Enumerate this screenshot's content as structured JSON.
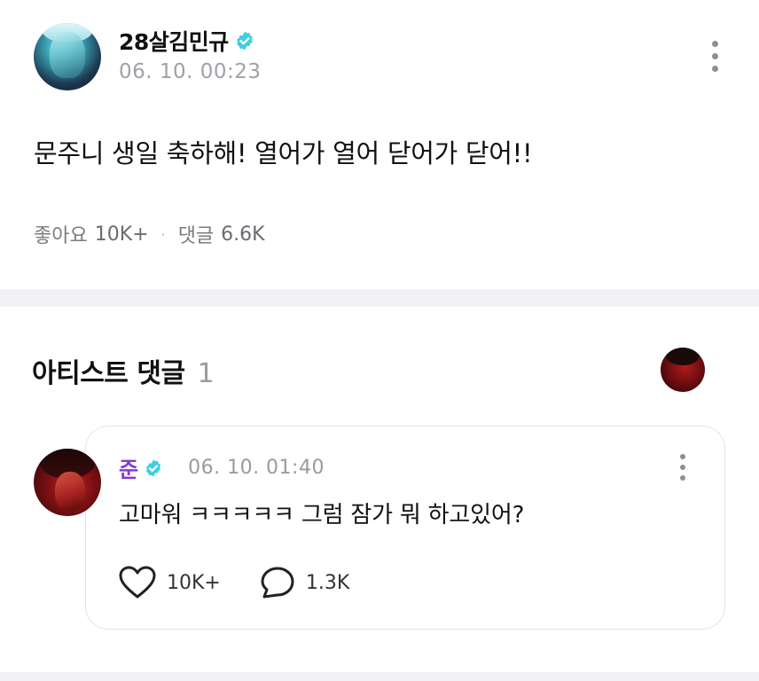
{
  "post": {
    "author": "28살김민규",
    "timestamp": "06. 10. 00:23",
    "body": "문주니 생일 축하해! 열어가 열어 닫어가 닫어!!",
    "likes_label": "좋아요",
    "likes_count": "10K+",
    "comments_label": "댓글",
    "comments_count": "6.6K",
    "separator": "·"
  },
  "artist_comments": {
    "title": "아티스트 댓글",
    "count": "1"
  },
  "comment": {
    "author": "준",
    "timestamp": "06. 10. 01:40",
    "body": "고마워 ㅋㅋㅋㅋㅋ 그럼 잠가 뭐 하고있어?",
    "likes_count": "10K+",
    "replies_count": "1.3K"
  },
  "colors": {
    "verified": "#3ecfe0",
    "comment_author": "#8a3ad0",
    "muted_text": "#a0a0a8",
    "divider": "#f2f2f4"
  },
  "icons": [
    "verified-badge-icon",
    "more-vertical-icon",
    "heart-icon",
    "comment-bubble-icon"
  ]
}
